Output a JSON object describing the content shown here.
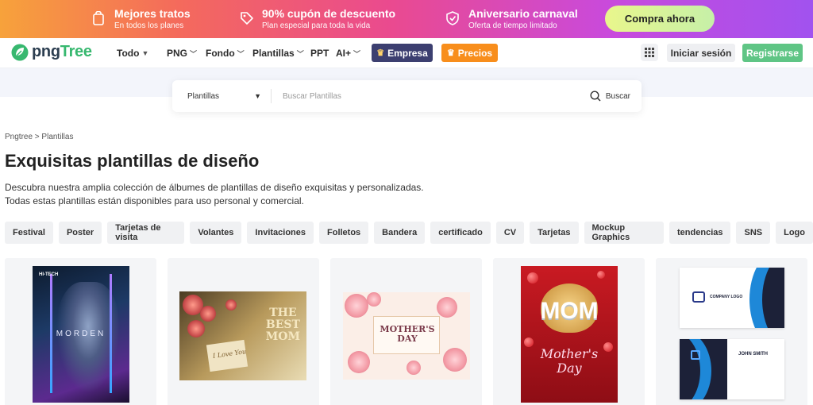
{
  "promo": {
    "items": [
      {
        "title": "Mejores tratos",
        "sub": "En todos los planes",
        "icon": "bag-icon"
      },
      {
        "title": "90% cupón de descuento",
        "sub": "Plan especial para toda la vida",
        "icon": "tag-icon"
      },
      {
        "title": "Aniversario carnaval",
        "sub": "Oferta de tiempo limitado",
        "icon": "shield-icon"
      }
    ],
    "cta": "Compra ahora"
  },
  "header": {
    "logo": {
      "prefix": "png",
      "suffix": "Tree"
    },
    "nav": [
      "Todo",
      "PNG",
      "Fondo",
      "Plantillas",
      "PPT",
      "AI+"
    ],
    "empresa": "Empresa",
    "precios": "Precios",
    "login": "Iniciar sesión",
    "register": "Registrarse"
  },
  "search": {
    "category": "Plantillas",
    "placeholder": "Buscar Plantillas",
    "button": "Buscar"
  },
  "breadcrumb": "Pngtree > Plantillas",
  "title": "Exquisitas plantillas de diseño",
  "description": [
    "Descubra nuestra amplia colección de álbumes de plantillas de diseño exquisitas y personalizadas.",
    "Todas estas plantillas están disponibles para uso personal y comercial."
  ],
  "tags": [
    "Festival",
    "Poster",
    "Tarjetas de visita",
    "Volantes",
    "Invitaciones",
    "Folletos",
    "Bandera",
    "certificado",
    "CV",
    "Tarjetas",
    "Mockup Graphics",
    "tendencias",
    "SNS",
    "Logo"
  ],
  "cards": {
    "c1": {
      "top": "HI-TECH",
      "word": "MORDEN"
    },
    "c2": {
      "best": "THE\nBEST\nMOM",
      "card": "I Love You"
    },
    "c3": {
      "title": "MOTHER'S DAY"
    },
    "c4": {
      "mom": "MOM",
      "sub": "Mother's\nDay"
    },
    "c5": {
      "company": "COMPANY LOGO",
      "name": "JOHN SMITH"
    }
  }
}
